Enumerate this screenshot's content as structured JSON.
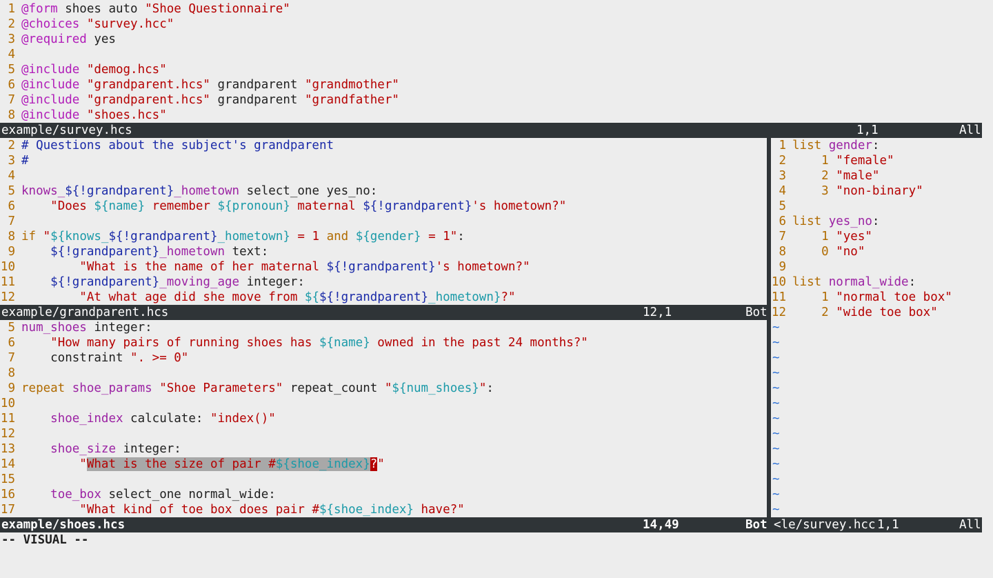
{
  "top_pane": {
    "lines": [
      {
        "n": "1",
        "segs": [
          {
            "t": "@form",
            "c": "dir"
          },
          {
            "t": " shoes auto ",
            "c": "plain"
          },
          {
            "t": "\"Shoe Questionnaire\"",
            "c": "str"
          }
        ]
      },
      {
        "n": "2",
        "segs": [
          {
            "t": "@choices",
            "c": "dir"
          },
          {
            "t": " ",
            "c": "plain"
          },
          {
            "t": "\"survey.hcc\"",
            "c": "str"
          }
        ]
      },
      {
        "n": "3",
        "segs": [
          {
            "t": "@required",
            "c": "dir"
          },
          {
            "t": " yes",
            "c": "plain"
          }
        ]
      },
      {
        "n": "4",
        "segs": []
      },
      {
        "n": "5",
        "segs": [
          {
            "t": "@include",
            "c": "dir"
          },
          {
            "t": " ",
            "c": "plain"
          },
          {
            "t": "\"demog.hcs\"",
            "c": "str"
          }
        ]
      },
      {
        "n": "6",
        "segs": [
          {
            "t": "@include",
            "c": "dir"
          },
          {
            "t": " ",
            "c": "plain"
          },
          {
            "t": "\"grandparent.hcs\"",
            "c": "str"
          },
          {
            "t": " grandparent ",
            "c": "plain"
          },
          {
            "t": "\"grandmother\"",
            "c": "str"
          }
        ]
      },
      {
        "n": "7",
        "segs": [
          {
            "t": "@include",
            "c": "dir"
          },
          {
            "t": " ",
            "c": "plain"
          },
          {
            "t": "\"grandparent.hcs\"",
            "c": "str"
          },
          {
            "t": " grandparent ",
            "c": "plain"
          },
          {
            "t": "\"grandfather\"",
            "c": "str"
          }
        ]
      },
      {
        "n": "8",
        "segs": [
          {
            "t": "@include",
            "c": "dir"
          },
          {
            "t": " ",
            "c": "plain"
          },
          {
            "t": "\"shoes.hcs\"",
            "c": "str"
          }
        ]
      }
    ],
    "status": {
      "file": "example/survey.hcs",
      "pos": "1,1",
      "pct": "All"
    }
  },
  "middle_pane": {
    "lines": [
      {
        "n": "2",
        "segs": [
          {
            "t": "# Questions about the subject's grandparent",
            "c": "cmt"
          }
        ]
      },
      {
        "n": "3",
        "segs": [
          {
            "t": "#",
            "c": "cmt"
          }
        ]
      },
      {
        "n": "4",
        "segs": []
      },
      {
        "n": "5",
        "segs": [
          {
            "t": "knows_",
            "c": "name"
          },
          {
            "t": "${!grandparent}",
            "c": "blue"
          },
          {
            "t": "_hometown",
            "c": "name"
          },
          {
            "t": " select_one yes_no:",
            "c": "plain"
          }
        ]
      },
      {
        "n": "6",
        "segs": [
          {
            "t": "    ",
            "c": "plain"
          },
          {
            "t": "\"Does ",
            "c": "str"
          },
          {
            "t": "${name}",
            "c": "var"
          },
          {
            "t": " remember ",
            "c": "str"
          },
          {
            "t": "${pronoun}",
            "c": "var"
          },
          {
            "t": " maternal ",
            "c": "str"
          },
          {
            "t": "${!grandparent}",
            "c": "blue"
          },
          {
            "t": "'s hometown?\"",
            "c": "str"
          }
        ]
      },
      {
        "n": "7",
        "segs": []
      },
      {
        "n": "8",
        "segs": [
          {
            "t": "if",
            "c": "ctl"
          },
          {
            "t": " ",
            "c": "plain"
          },
          {
            "t": "\"",
            "c": "str"
          },
          {
            "t": "${knows_",
            "c": "var"
          },
          {
            "t": "${!grandparent}",
            "c": "blue"
          },
          {
            "t": "_hometown}",
            "c": "var"
          },
          {
            "t": " = 1 ",
            "c": "str"
          },
          {
            "t": "and",
            "c": "ctl"
          },
          {
            "t": " ",
            "c": "str"
          },
          {
            "t": "${gender}",
            "c": "var"
          },
          {
            "t": " = 1\"",
            "c": "str"
          },
          {
            "t": ":",
            "c": "plain"
          }
        ]
      },
      {
        "n": "9",
        "segs": [
          {
            "t": "    ",
            "c": "plain"
          },
          {
            "t": "${!grandparent}",
            "c": "blue"
          },
          {
            "t": "_hometown",
            "c": "name"
          },
          {
            "t": " text:",
            "c": "plain"
          }
        ]
      },
      {
        "n": "10",
        "segs": [
          {
            "t": "        ",
            "c": "plain"
          },
          {
            "t": "\"What is the name of her maternal ",
            "c": "str"
          },
          {
            "t": "${!grandparent}",
            "c": "blue"
          },
          {
            "t": "'s hometown?\"",
            "c": "str"
          }
        ]
      },
      {
        "n": "11",
        "segs": [
          {
            "t": "    ",
            "c": "plain"
          },
          {
            "t": "${!grandparent}",
            "c": "blue"
          },
          {
            "t": "_moving_age",
            "c": "name"
          },
          {
            "t": " integer:",
            "c": "plain"
          }
        ]
      },
      {
        "n": "12",
        "segs": [
          {
            "t": "        ",
            "c": "plain"
          },
          {
            "t": "\"At what age did she move from ",
            "c": "str"
          },
          {
            "t": "${",
            "c": "var"
          },
          {
            "t": "${!grandparent}",
            "c": "blue"
          },
          {
            "t": "_hometown}",
            "c": "var"
          },
          {
            "t": "?\"",
            "c": "str"
          }
        ]
      }
    ],
    "status": {
      "file": "example/grandparent.hcs",
      "pos": "12,1",
      "pct": "Bot"
    }
  },
  "bottom_pane": {
    "lines": [
      {
        "n": "5",
        "segs": [
          {
            "t": "num_shoes",
            "c": "name"
          },
          {
            "t": " integer:",
            "c": "plain"
          }
        ]
      },
      {
        "n": "6",
        "segs": [
          {
            "t": "    ",
            "c": "plain"
          },
          {
            "t": "\"How many pairs of running shoes has ",
            "c": "str"
          },
          {
            "t": "${name}",
            "c": "var"
          },
          {
            "t": " owned in the past 24 months?\"",
            "c": "str"
          }
        ]
      },
      {
        "n": "7",
        "segs": [
          {
            "t": "    constraint ",
            "c": "plain"
          },
          {
            "t": "\". >= 0\"",
            "c": "str"
          }
        ]
      },
      {
        "n": "8",
        "segs": []
      },
      {
        "n": "9",
        "segs": [
          {
            "t": "repeat",
            "c": "ctl"
          },
          {
            "t": " ",
            "c": "plain"
          },
          {
            "t": "shoe_params",
            "c": "name"
          },
          {
            "t": " ",
            "c": "plain"
          },
          {
            "t": "\"Shoe Parameters\"",
            "c": "str"
          },
          {
            "t": " repeat_count ",
            "c": "plain"
          },
          {
            "t": "\"",
            "c": "str"
          },
          {
            "t": "${num_shoes}",
            "c": "var"
          },
          {
            "t": "\"",
            "c": "str"
          },
          {
            "t": ":",
            "c": "plain"
          }
        ]
      },
      {
        "n": "10",
        "segs": []
      },
      {
        "n": "11",
        "segs": [
          {
            "t": "    ",
            "c": "plain"
          },
          {
            "t": "shoe_index",
            "c": "name"
          },
          {
            "t": " calculate: ",
            "c": "plain"
          },
          {
            "t": "\"index()\"",
            "c": "str"
          }
        ]
      },
      {
        "n": "12",
        "segs": []
      },
      {
        "n": "13",
        "segs": [
          {
            "t": "    ",
            "c": "plain"
          },
          {
            "t": "shoe_size",
            "c": "name"
          },
          {
            "t": " integer:",
            "c": "plain"
          }
        ]
      },
      {
        "n": "14",
        "segs": [
          {
            "t": "        ",
            "c": "plain"
          },
          {
            "t": "\"",
            "c": "str"
          },
          {
            "t": "What is the size of pair #",
            "c": "str sel"
          },
          {
            "t": "${shoe_index}",
            "c": "var sel"
          },
          {
            "t": "?",
            "c": "cursor"
          },
          {
            "t": "\"",
            "c": "str"
          }
        ]
      },
      {
        "n": "15",
        "segs": []
      },
      {
        "n": "16",
        "segs": [
          {
            "t": "    ",
            "c": "plain"
          },
          {
            "t": "toe_box",
            "c": "name"
          },
          {
            "t": " select_one normal_wide:",
            "c": "plain"
          }
        ]
      },
      {
        "n": "17",
        "segs": [
          {
            "t": "        ",
            "c": "plain"
          },
          {
            "t": "\"What kind of toe box does pair #",
            "c": "str"
          },
          {
            "t": "${shoe_index}",
            "c": "var"
          },
          {
            "t": " have?\"",
            "c": "str"
          }
        ]
      }
    ],
    "status": {
      "file": "example/shoes.hcs",
      "pos": "14,49",
      "pct": "Bot"
    }
  },
  "right_pane": {
    "lines": [
      {
        "n": "1",
        "segs": [
          {
            "t": "list",
            "c": "ctl"
          },
          {
            "t": " ",
            "c": "plain"
          },
          {
            "t": "gender",
            "c": "name"
          },
          {
            "t": ":",
            "c": "plain"
          }
        ]
      },
      {
        "n": "2",
        "segs": [
          {
            "t": "    ",
            "c": "plain"
          },
          {
            "t": "1 ",
            "c": "ctl"
          },
          {
            "t": "\"female\"",
            "c": "str"
          }
        ]
      },
      {
        "n": "3",
        "segs": [
          {
            "t": "    ",
            "c": "plain"
          },
          {
            "t": "2 ",
            "c": "ctl"
          },
          {
            "t": "\"male\"",
            "c": "str"
          }
        ]
      },
      {
        "n": "4",
        "segs": [
          {
            "t": "    ",
            "c": "plain"
          },
          {
            "t": "3 ",
            "c": "ctl"
          },
          {
            "t": "\"non-binary\"",
            "c": "str"
          }
        ]
      },
      {
        "n": "5",
        "segs": []
      },
      {
        "n": "6",
        "segs": [
          {
            "t": "list",
            "c": "ctl"
          },
          {
            "t": " ",
            "c": "plain"
          },
          {
            "t": "yes_no",
            "c": "name"
          },
          {
            "t": ":",
            "c": "plain"
          }
        ]
      },
      {
        "n": "7",
        "segs": [
          {
            "t": "    ",
            "c": "plain"
          },
          {
            "t": "1 ",
            "c": "ctl"
          },
          {
            "t": "\"yes\"",
            "c": "str"
          }
        ]
      },
      {
        "n": "8",
        "segs": [
          {
            "t": "    ",
            "c": "plain"
          },
          {
            "t": "0 ",
            "c": "ctl"
          },
          {
            "t": "\"no\"",
            "c": "str"
          }
        ]
      },
      {
        "n": "9",
        "segs": []
      },
      {
        "n": "10",
        "segs": [
          {
            "t": "list",
            "c": "ctl"
          },
          {
            "t": " ",
            "c": "plain"
          },
          {
            "t": "normal_wide",
            "c": "name"
          },
          {
            "t": ":",
            "c": "plain"
          }
        ]
      },
      {
        "n": "11",
        "segs": [
          {
            "t": "    ",
            "c": "plain"
          },
          {
            "t": "1 ",
            "c": "ctl"
          },
          {
            "t": "\"normal toe box\"",
            "c": "str"
          }
        ]
      },
      {
        "n": "12",
        "segs": [
          {
            "t": "    ",
            "c": "plain"
          },
          {
            "t": "2 ",
            "c": "ctl"
          },
          {
            "t": "\"wide toe box\"",
            "c": "str"
          }
        ]
      }
    ],
    "tilde": "~",
    "tilde_count": 13,
    "status": {
      "file": "<le/survey.hcc",
      "pos": "1,1",
      "pct": "All"
    }
  },
  "command_line": "-- VISUAL --"
}
